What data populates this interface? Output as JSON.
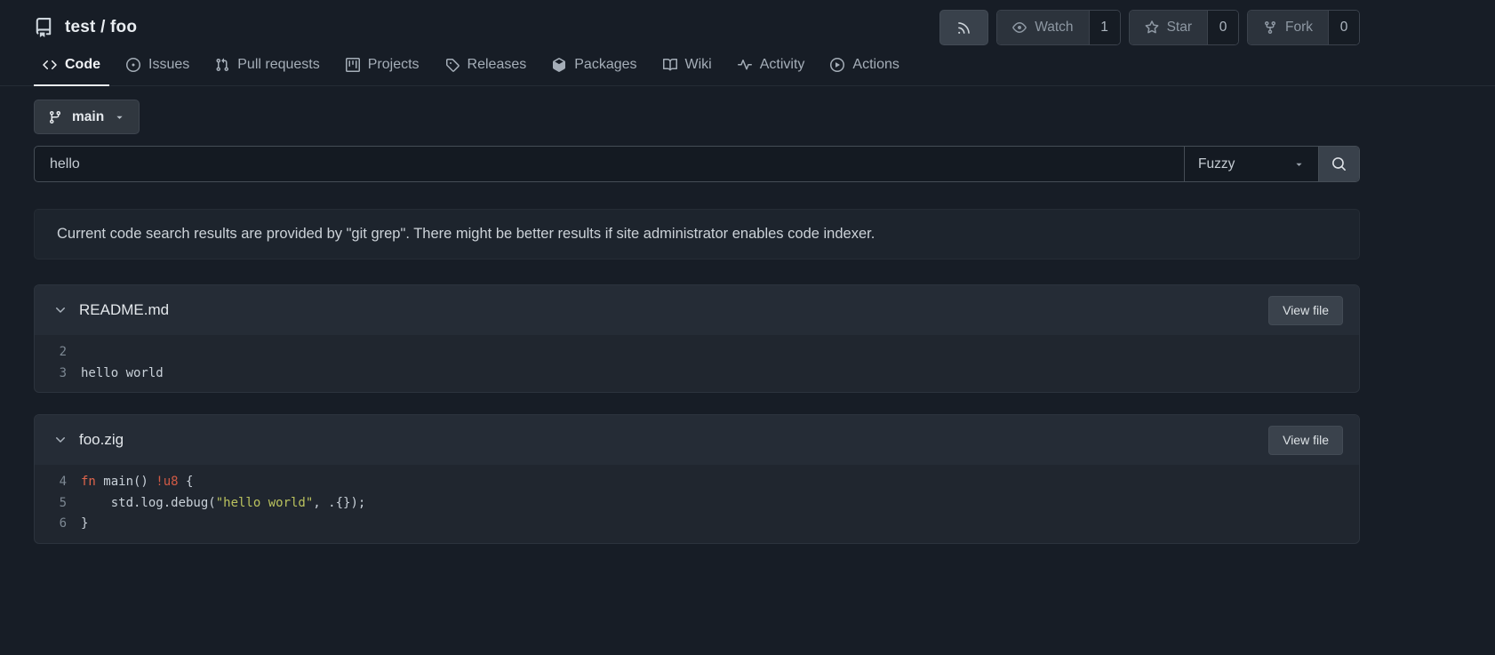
{
  "repo": {
    "title": "test / foo",
    "owner": "test",
    "name": "foo"
  },
  "header_actions": {
    "rss_icon": "rss-icon",
    "watch": {
      "label": "Watch",
      "count": "1",
      "icon": "eye-icon"
    },
    "star": {
      "label": "Star",
      "count": "0",
      "icon": "star-icon"
    },
    "fork": {
      "label": "Fork",
      "count": "0",
      "icon": "repo-forked-icon"
    }
  },
  "tabs": [
    {
      "label": "Code",
      "icon": "code-icon",
      "active": true
    },
    {
      "label": "Issues",
      "icon": "issue-opened-icon",
      "active": false
    },
    {
      "label": "Pull requests",
      "icon": "git-pull-request-icon",
      "active": false
    },
    {
      "label": "Projects",
      "icon": "project-icon",
      "active": false
    },
    {
      "label": "Releases",
      "icon": "tag-icon",
      "active": false
    },
    {
      "label": "Packages",
      "icon": "package-icon",
      "active": false
    },
    {
      "label": "Wiki",
      "icon": "book-icon",
      "active": false
    },
    {
      "label": "Activity",
      "icon": "pulse-icon",
      "active": false
    },
    {
      "label": "Actions",
      "icon": "play-icon",
      "active": false
    }
  ],
  "branch_selector": {
    "label": "main",
    "icon": "git-branch-icon"
  },
  "search": {
    "value": "hello",
    "mode": "Fuzzy",
    "icon": "search-icon"
  },
  "notice": "Current code search results are provided by \"git grep\". There might be better results if site administrator enables code indexer.",
  "results": [
    {
      "filename": "README.md",
      "view_file_label": "View file",
      "lines": [
        {
          "number": "2",
          "segments": [
            {
              "type": "default",
              "text": ""
            }
          ]
        },
        {
          "number": "3",
          "segments": [
            {
              "type": "default",
              "text": "hello world"
            }
          ]
        }
      ]
    },
    {
      "filename": "foo.zig",
      "view_file_label": "View file",
      "lines": [
        {
          "number": "4",
          "segments": [
            {
              "type": "keyword",
              "text": "fn"
            },
            {
              "type": "default",
              "text": " main() "
            },
            {
              "type": "type",
              "text": "!u8"
            },
            {
              "type": "default",
              "text": " {"
            }
          ]
        },
        {
          "number": "5",
          "segments": [
            {
              "type": "default",
              "text": "    std.log.debug("
            },
            {
              "type": "string",
              "text": "\"hello world\""
            },
            {
              "type": "default",
              "text": ", .{});"
            }
          ]
        },
        {
          "number": "6",
          "segments": [
            {
              "type": "default",
              "text": "}"
            }
          ]
        }
      ]
    }
  ],
  "colors": {
    "page_background": "#171d26",
    "panel_background": "#20262f",
    "panel_header_background": "#252c36",
    "syntax_keyword": "#e0654c",
    "syntax_type": "#d05a45",
    "syntax_string": "#bac25e"
  }
}
